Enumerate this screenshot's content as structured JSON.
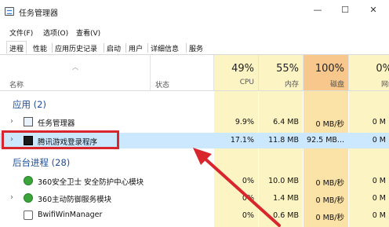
{
  "window": {
    "title": "任务管理器",
    "minimize": "—",
    "maximize": "☐",
    "close": "✕"
  },
  "menu": [
    "文件(F)",
    "选项(O)",
    "查看(V)"
  ],
  "tabs": [
    "进程",
    "性能",
    "应用历史记录",
    "启动",
    "用户",
    "详细信息",
    "服务"
  ],
  "active_tab": "进程",
  "columns": {
    "name": "名称",
    "status": "状态",
    "cpu": {
      "pct": "49%",
      "label": "CPU"
    },
    "memory": {
      "pct": "55%",
      "label": "内存"
    },
    "disk": {
      "pct": "100%",
      "label": "磁盘"
    },
    "network": {
      "pct": "0%",
      "label": "网络"
    }
  },
  "groups": {
    "apps": "应用 (2)",
    "background": "后台进程 (28)"
  },
  "apps": [
    {
      "name": "任务管理器",
      "cpu": "9.9%",
      "memory": "6.4 MB",
      "disk": "0 MB/秒",
      "network": "0 M",
      "icon": "task-manager-icon"
    },
    {
      "name": "腾讯游戏登录程序",
      "cpu": "17.1%",
      "memory": "11.8 MB",
      "disk": "92.5 MB...",
      "network": "0 M",
      "icon": "tencent-game-icon"
    }
  ],
  "background": [
    {
      "name": "360安全卫士 安全防护中心模块",
      "cpu": "0%",
      "memory": "10.0 MB",
      "disk": "0 MB/秒",
      "network": "0 M",
      "icon": "360-shield-icon"
    },
    {
      "name": "360主动防御服务模块",
      "cpu": "0%",
      "memory": "1.4 MB",
      "disk": "0 MB/秒",
      "network": "0 M",
      "icon": "360-shield-icon"
    },
    {
      "name": "BwifiWinManager",
      "cpu": "0%",
      "memory": "0.6 MB",
      "disk": "0 MB/秒",
      "network": "0 M",
      "icon": "wifi-icon"
    }
  ],
  "colors": {
    "cpu_bg": "#fdf4c4",
    "mem_bg": "#fdf4c4",
    "disk_bg": "#fbe3a8",
    "disk_header": "#f7c78b",
    "highlight": "#d9262c",
    "selection": "#cce8ff",
    "group_text": "#1f4e9a"
  }
}
